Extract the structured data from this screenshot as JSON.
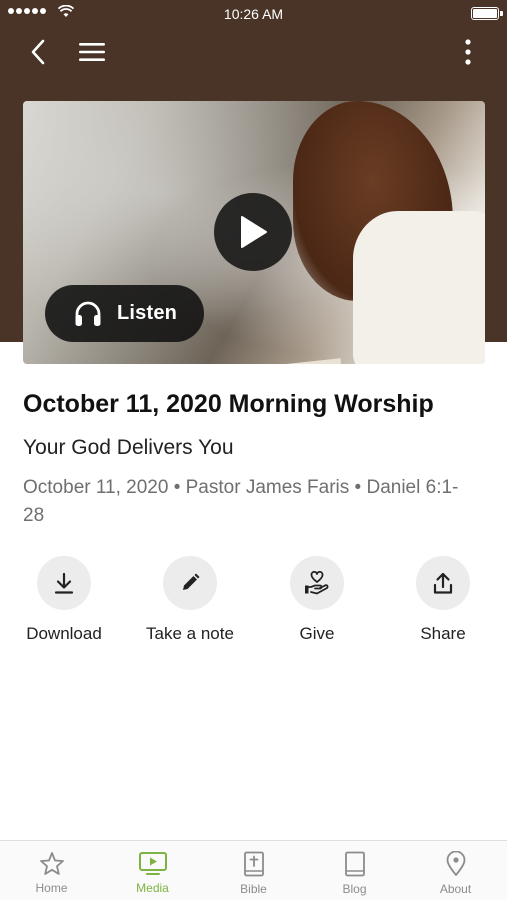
{
  "status_bar": {
    "time": "10:26 AM"
  },
  "sermon": {
    "title": "October 11, 2020 Morning Worship",
    "subtitle": "Your God Delivers You",
    "meta": "October 11, 2020 • Pastor James Faris • Daniel 6:1-28"
  },
  "player": {
    "listen_label": "Listen"
  },
  "actions": [
    {
      "label": "Download",
      "icon": "download-icon"
    },
    {
      "label": "Take a note",
      "icon": "pencil-icon"
    },
    {
      "label": "Give",
      "icon": "give-heart-hand-icon"
    },
    {
      "label": "Share",
      "icon": "share-icon"
    }
  ],
  "tabs": [
    {
      "label": "Home",
      "icon": "star-icon",
      "active": false
    },
    {
      "label": "Media",
      "icon": "tv-play-icon",
      "active": true
    },
    {
      "label": "Bible",
      "icon": "bible-icon",
      "active": false
    },
    {
      "label": "Blog",
      "icon": "book-icon",
      "active": false
    },
    {
      "label": "About",
      "icon": "location-pin-icon",
      "active": false
    }
  ],
  "colors": {
    "header_bg": "#4a3428",
    "accent": "#7cb342",
    "tab_inactive": "#8c8c8c",
    "meta_text": "#6f6f6f"
  }
}
